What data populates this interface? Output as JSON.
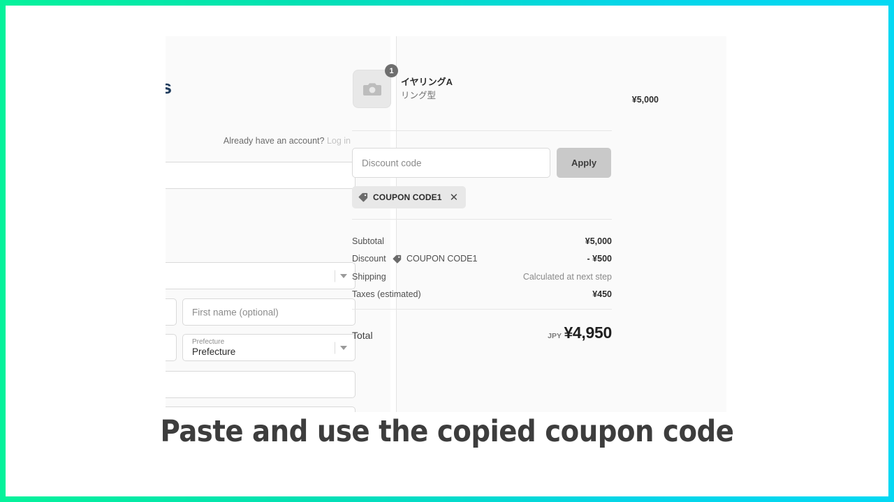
{
  "theme": {
    "frame_gradient_start": "#05f29b",
    "frame_gradient_end": "#03d8f3",
    "panel_bg": "#fafafa",
    "apply_button_bg": "#c9c9c9",
    "chip_bg": "#e8e8e8",
    "badge_bg": "#6e6e6e"
  },
  "form": {
    "brand_fragment": "s",
    "account_prompt": "Already have an account?",
    "login_link": "Log in",
    "fields": {
      "email_placeholder": "",
      "country_value": "",
      "last_name_placeholder": "",
      "first_name_placeholder": "First name (optional)",
      "postal_placeholder": "",
      "prefecture_label": "Prefecture",
      "prefecture_value": "Prefecture",
      "city_placeholder": "",
      "address_placeholder": ""
    }
  },
  "summary": {
    "product": {
      "quantity": "1",
      "title": "イヤリングA",
      "variant": "リング型",
      "price": "¥5,000",
      "thumbnail_icon": "camera-icon"
    },
    "discount": {
      "input_placeholder": "Discount code",
      "apply_label": "Apply",
      "applied_coupon": "COUPON CODE1",
      "remove_label": "✕",
      "tag_icon": "tag-icon"
    },
    "totals": [
      {
        "label": "Subtotal",
        "value": "¥5,000",
        "muted": false
      },
      {
        "label": "Discount",
        "tag": "COUPON CODE1",
        "value": "- ¥500",
        "muted": false
      },
      {
        "label": "Shipping",
        "value": "Calculated at next step",
        "muted": true
      },
      {
        "label": "Taxes (estimated)",
        "value": "¥450",
        "muted": false
      }
    ],
    "total": {
      "label": "Total",
      "currency": "JPY",
      "amount": "¥4,950"
    }
  },
  "caption": "Paste and use the copied coupon code"
}
